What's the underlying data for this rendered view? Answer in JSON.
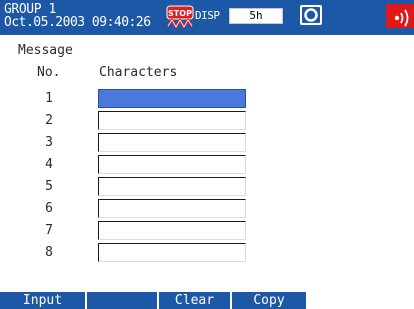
{
  "status_bar": {
    "group": "GROUP 1",
    "datetime": "Oct.05.2003 09:40:26",
    "stop_badge_text": "STOP",
    "disp_label": "DISP",
    "display_span": "5h"
  },
  "screen": {
    "title": "Message",
    "col_no_label": "No.",
    "col_chars_label": "Characters",
    "selected_row": 1
  },
  "messages": [
    {
      "no": "1",
      "text": ""
    },
    {
      "no": "2",
      "text": ""
    },
    {
      "no": "3",
      "text": ""
    },
    {
      "no": "4",
      "text": ""
    },
    {
      "no": "5",
      "text": ""
    },
    {
      "no": "6",
      "text": ""
    },
    {
      "no": "7",
      "text": ""
    },
    {
      "no": "8",
      "text": ""
    }
  ],
  "softkeys": [
    "Input",
    "",
    "Clear",
    "Copy"
  ],
  "colors": {
    "header_bar": "#1d58a6",
    "selected_field": "#4a78dd",
    "stop_badge": "#e02020",
    "alarm_icon": "#e01818"
  },
  "icons": [
    "stop-indicator-icon",
    "snapshot-icon",
    "alarm-icon"
  ]
}
